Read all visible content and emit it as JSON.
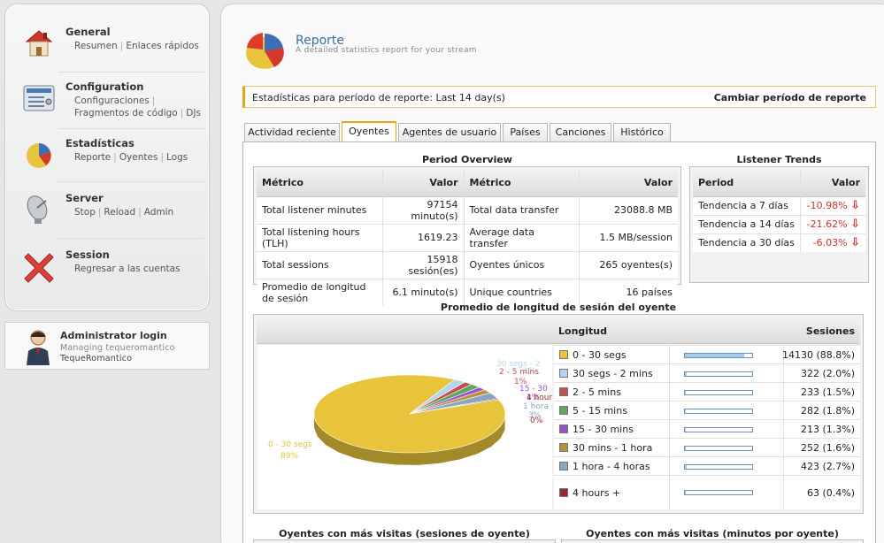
{
  "sidebar": {
    "general": {
      "title": "General",
      "links": [
        "Resumen",
        "Enlaces rápidos"
      ]
    },
    "configuration": {
      "title": "Configuration",
      "links": [
        "Configuraciones",
        "Fragmentos de código",
        "DJs"
      ]
    },
    "statistics": {
      "title": "Estadísticas",
      "links": [
        "Reporte",
        "Oyentes",
        "Logs"
      ]
    },
    "server": {
      "title": "Server",
      "links": [
        "Stop",
        "Reload",
        "Admin"
      ]
    },
    "session": {
      "title": "Session",
      "links": [
        "Regresar a las cuentas"
      ]
    }
  },
  "admin": {
    "title": "Administrator login",
    "managing": "Managing tequeromantico",
    "username": "TequeRomantico"
  },
  "report": {
    "title": "Reporte",
    "subtitle": "A detailed statistics report for your stream"
  },
  "period": {
    "label": "Estadísticas para período de reporte: Last 14 day(s)",
    "change": "Cambiar período de reporte"
  },
  "tabs": [
    "Actividad reciente",
    "Oyentes",
    "Agentes de usuario",
    "Países",
    "Canciones",
    "Histórico"
  ],
  "overview": {
    "title": "Period Overview",
    "headers": [
      "Métrico",
      "Valor",
      "Métrico",
      "Valor"
    ],
    "rows": [
      [
        "Total listener minutes",
        "97154 minuto(s)",
        "Total data transfer",
        "23088.8 MB"
      ],
      [
        "Total listening hours (TLH)",
        "1619.23",
        "Average data transfer",
        "1.5 MB/session"
      ],
      [
        "Total sessions",
        "15918 sesión(es)",
        "Oyentes únicos",
        "265 oyentes(s)"
      ],
      [
        "Promedio de longitud de sesión",
        "6.1 minuto(s)",
        "Unique countries",
        "16 países"
      ]
    ]
  },
  "trends": {
    "title": "Listener Trends",
    "headers": [
      "Period",
      "Valor"
    ],
    "rows": [
      [
        "Tendencia a 7 días",
        "-10.98%"
      ],
      [
        "Tendencia a 14 días",
        "-21.62%"
      ],
      [
        "Tendencia a 30 días",
        "-6.03%"
      ]
    ],
    "arrow": "⇩"
  },
  "sessions": {
    "title": "Promedio de longitud de sesión del oyente",
    "headers": [
      "Longitud",
      "Sesiones"
    ]
  },
  "chart_data": {
    "type": "pie",
    "categories": [
      "0 - 30 segs",
      "30 segs - 2 mins",
      "2 - 5 mins",
      "5 - 15 mins",
      "15 - 30 mins",
      "30 mins - 1 hora",
      "1 hora - 4 horas",
      "4 hours +"
    ],
    "values": [
      14130,
      322,
      233,
      282,
      213,
      252,
      423,
      63
    ],
    "value_labels": [
      "14130 (88.8%)",
      "322 (2.0%)",
      "233 (1.5%)",
      "282 (1.8%)",
      "213 (1.3%)",
      "252 (1.6%)",
      "423 (2.7%)",
      "63 (0.4%)"
    ],
    "percents": [
      88.8,
      2.0,
      1.5,
      1.8,
      1.3,
      1.6,
      2.7,
      0.4
    ],
    "colors": [
      "#e8c33c",
      "#b7d4ee",
      "#c0504d",
      "#5aa95a",
      "#9b4fd0",
      "#b8923a",
      "#8aa5bf",
      "#9b2b2b"
    ],
    "slice_labels": [
      {
        "name": "0 - 30 segs",
        "pct": "89%"
      },
      {
        "name": "30 segs - 2",
        "pct": "2%"
      },
      {
        "name": "2 - 5 mins",
        "pct": "1%"
      },
      {
        "name": "15 - 30",
        "pct": "1%"
      },
      {
        "name": "1 hora - 4 horas",
        "pct": "3%"
      },
      {
        "name": "4 hours +",
        "pct": "0%"
      }
    ]
  },
  "bottom_titles": [
    "Oyentes con más visitas (sesiones de oyente)",
    "Oyentes con más visitas (minutos por oyente)"
  ]
}
